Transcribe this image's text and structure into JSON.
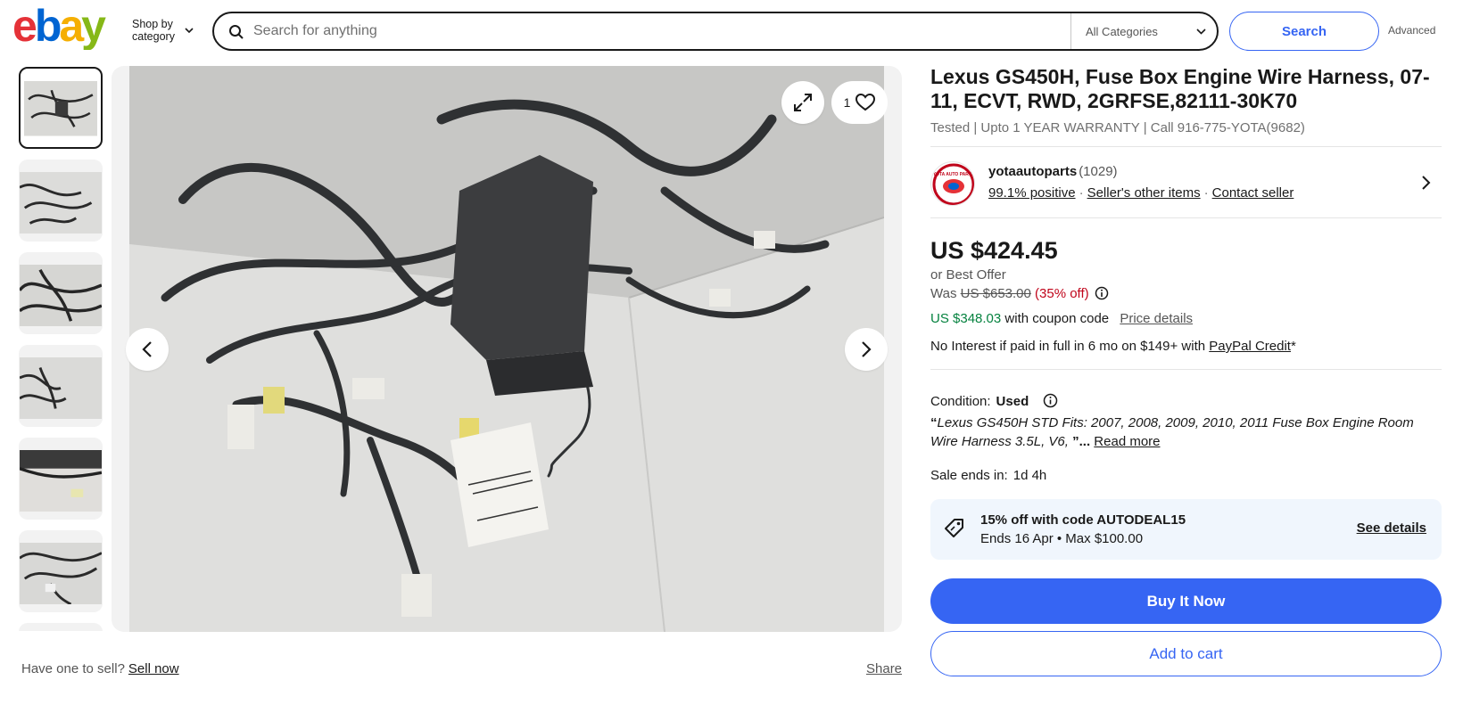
{
  "header": {
    "logo_text": "ebay",
    "shop_by_line1": "Shop by",
    "shop_by_line2": "category",
    "search_placeholder": "Search for anything",
    "category_selected": "All Categories",
    "search_button": "Search",
    "advanced_link": "Advanced"
  },
  "gallery": {
    "thumbnail_count": 7,
    "watch_count": "1",
    "have_one_text": "Have one to sell?",
    "sell_now_link": "Sell now",
    "share_link": "Share"
  },
  "listing": {
    "title": "Lexus GS450H, Fuse Box Engine Wire Harness, 07-11, ECVT, RWD, 2GRFSE,82111-30K70",
    "subtitle": "Tested | Upto 1 YEAR WARRANTY | Call 916-775-YOTA(9682)"
  },
  "seller": {
    "logo_text": "YOTA AUTO PARTS",
    "name": "yotaautoparts",
    "feedback_count": "(1029)",
    "positive": "99.1% positive",
    "other_items": "Seller's other items",
    "contact": "Contact seller"
  },
  "pricing": {
    "price": "US $424.45",
    "best_offer": "or Best Offer",
    "was_label": "Was",
    "was_price": "US $653.00",
    "discount": "(35% off)",
    "coupon_price": "US $348.03",
    "coupon_text": "with coupon code",
    "price_details_link": "Price details",
    "paypal_text": "No Interest if paid in full in 6 mo on $149+ with",
    "paypal_link": "PayPal Credit",
    "paypal_suffix": "*"
  },
  "details": {
    "condition_label": "Condition:",
    "condition_value": "Used",
    "description_open": "“",
    "description": "Lexus GS450H STD Fits: 2007, 2008, 2009, 2010, 2011 Fuse Box Engine Room Wire Harness 3.5L, V6, ",
    "description_close": "”...",
    "read_more": "Read more",
    "sale_ends_label": "Sale ends in:",
    "sale_ends_value": "1d 4h"
  },
  "promo": {
    "line1": "15% off with code AUTODEAL15",
    "line2": "Ends 16 Apr • Max $100.00",
    "see_details": "See details"
  },
  "actions": {
    "buy_now": "Buy It Now",
    "add_to_cart": "Add to cart"
  },
  "colors": {
    "accent_blue": "#3665f3",
    "sale_red": "#c0051b",
    "coupon_green": "#05823f",
    "promo_bg": "#f0f6fd"
  }
}
